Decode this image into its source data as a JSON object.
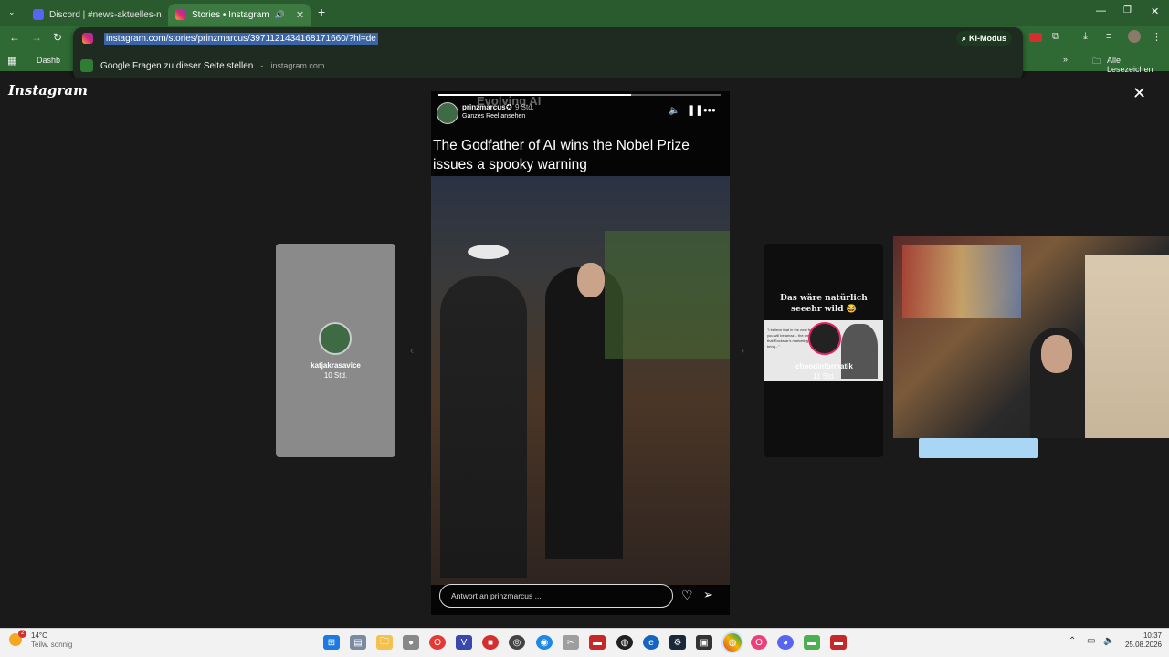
{
  "browser": {
    "tabs": [
      {
        "label": "Discord | #news-aktuelles-n…",
        "active": false
      },
      {
        "label": "Stories • Instagram",
        "active": true
      }
    ],
    "new_tab_label": "+",
    "url": "instagram.com/stories/prinzmarcus/3971121434168171660/?hl=de",
    "suggestion": {
      "title": "Google Fragen zu dieser Seite stellen",
      "separator": "-",
      "domain": "instagram.com"
    },
    "ki_mode_label": "KI-Modus",
    "bookmarks": {
      "first": "Dashb",
      "all_label": "Alle Lesezeichen"
    }
  },
  "instagram": {
    "logo": "Instagram",
    "main_story": {
      "username": "prinzmarcus",
      "time": "9 Std.",
      "channel": "Evolving AI",
      "reel_link": "Ganzes Reel ansehen",
      "headline": "The Godfather of AI wins the Nobel Prize issues a spooky warning",
      "reply_placeholder": "Antwort an prinzmarcus ...",
      "progress": 0.68
    },
    "left_story": {
      "username": "katjakrasavice",
      "time": "10 Std."
    },
    "right_story": {
      "caption": "Das wäre natürlich seeehr wild 😂",
      "username": "choodinformatik",
      "time": "11 Std.",
      "quote": "\"I believe that in the next few ye... you will be amaz... the creativity that Rockstar's marketing team will bring...\""
    }
  },
  "taskbar": {
    "weather_temp": "14°C",
    "weather_desc": "Teilw. sonnig",
    "notification_count": "2",
    "time": "10:37",
    "date": "25.08.2026"
  },
  "colors": {
    "tab_bg": "#2a5b2e",
    "toolbar_bg": "#2f6a34",
    "page_bg": "#1a1a1a",
    "taskbar_bg": "#f2f2f2"
  }
}
